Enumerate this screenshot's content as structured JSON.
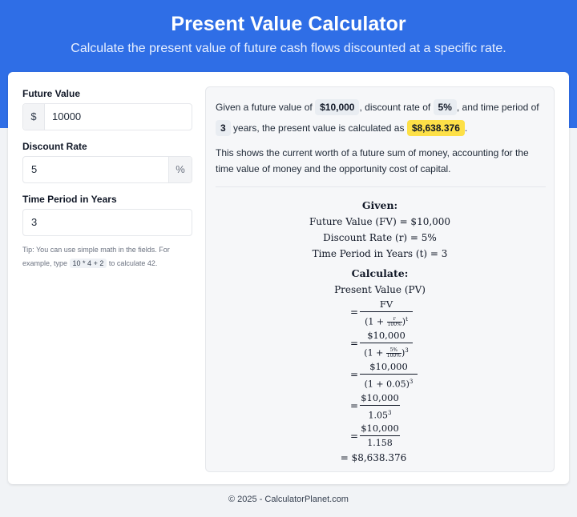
{
  "header": {
    "title": "Present Value Calculator",
    "subtitle": "Calculate the present value of future cash flows discounted at a specific rate."
  },
  "form": {
    "future_value": {
      "label": "Future Value",
      "prefix": "$",
      "value": "10000"
    },
    "discount_rate": {
      "label": "Discount Rate",
      "value": "5",
      "suffix": "%"
    },
    "time_period": {
      "label": "Time Period in Years",
      "value": "3"
    },
    "tip": {
      "before": "Tip: You can use simple math in the fields. For example, type",
      "code": "10 * 4 + 2",
      "after": "to calculate 42."
    }
  },
  "result": {
    "s1": "Given a future value of",
    "future_value": "$10,000",
    "s2": ", discount rate of",
    "rate": "5%",
    "s3": ", and time period of",
    "years": "3",
    "s4": "years, the present value is calculated as",
    "pv": "$8,638.376",
    "s5": ".",
    "explain": "This shows the current worth of a future sum of money, accounting for the time value of money and the opportunity cost of capital."
  },
  "math": {
    "given_heading": "Given:",
    "given_fv": "Future Value (FV) = $10,000",
    "given_r": "Discount Rate (r) = 5%",
    "given_t": "Time Period in Years (t) = 3",
    "calc_heading": "Calculate:",
    "pv_label": "Present Value (PV)",
    "eq": "=",
    "f1_num": "FV",
    "f1_den_a": "(1 + ",
    "f1_den_rn": "r",
    "f1_den_rd": "100%",
    "f1_den_b": ")",
    "f1_exp": "t",
    "f2_num": "$10,000",
    "f2_den_a": "(1 + ",
    "f2_den_rn": "5%",
    "f2_den_rd": "100%",
    "f2_den_b": ")",
    "f2_exp": "3",
    "f3_num": "$10,000",
    "f3_den": "(1 + 0.05)",
    "f3_exp": "3",
    "f4_num": "$10,000",
    "f4_den": "1.05",
    "f4_exp": "3",
    "f5_num": "$10,000",
    "f5_den": "1.158",
    "final": "= $8,638.376"
  },
  "footer": {
    "text": "© 2025 - CalculatorPlanet.com"
  }
}
